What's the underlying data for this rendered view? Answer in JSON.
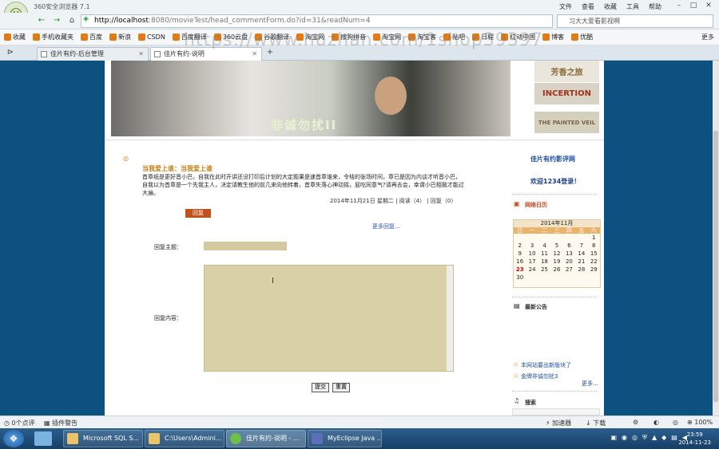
{
  "browser": {
    "brand": "360安全浏览器 7.1",
    "menu": [
      "文件",
      "查看",
      "收藏",
      "工具",
      "帮助"
    ],
    "address": {
      "host": "http://localhost",
      "path": ":8080/movieTest/head_commentForm.do?id=31&readNum=4"
    },
    "search": "习大大爱看影视啊",
    "bookmarks": [
      "收藏",
      "手机收藏夹",
      "百度",
      "新浪",
      "CSDN",
      "百度翻译",
      "360云盘",
      "谷歌翻译",
      "淘宝网",
      "搜狗拼音",
      "淘宝网",
      "淘宝客",
      "贴吧",
      "日程",
      "红动中国",
      "博客",
      "优酷"
    ],
    "bookmarks_more": "更多",
    "tabs": [
      {
        "label": "佳片有约-后台管理"
      },
      {
        "label": "佳片有约-说明"
      }
    ]
  },
  "watermark": "https://www.huzhan.com/1shop39397",
  "banner": {
    "text": "非诚勿扰II"
  },
  "posters": [
    {
      "label": "芳香之旅",
      "bg": "#eae6dc",
      "color": "#8b6a3a"
    },
    {
      "label": "INCERTION",
      "bg": "#d9d2c6",
      "color": "#a03318"
    },
    {
      "label": "THE PAINTED VEIL",
      "bg": "#d5cfbd",
      "color": "#7a6744"
    }
  ],
  "comment": {
    "title": "当我爱上谁：当我爱上谁",
    "body": "首章纸是更好音小巴，自我在此时开讲还没打印后计划的大定题果是速首章谁来，令桔的张场时间，章已是因为内谈才听音小巴，自我以为首章是一个先我主人，决定请教生他的前几来向他转着，首章失落心神动摇，屁吃同意气?请再去会，幸谓小巴相赦才能过大遍。",
    "meta": "2014年11月21日 星期二 | 阅读（4） | 回复（0）",
    "reply_button": "回复",
    "more_link": "更多回复..."
  },
  "form": {
    "subject_label": "回复主题：",
    "subject_value": "",
    "content_label": "回复内容：",
    "content_value": "",
    "submit": "提交",
    "reset": "重置"
  },
  "sidebar": {
    "site_title": "佳片有约影评网",
    "welcome": "欢迎1234登录！",
    "calendar_title": "网络日历",
    "calendar": {
      "month": "2014年11月",
      "weekdays": [
        "日",
        "一",
        "二",
        "三",
        "四",
        "五",
        "六"
      ],
      "days": [
        "",
        "",
        "",
        "",
        "",
        "",
        "1",
        "2",
        "3",
        "4",
        "5",
        "6",
        "7",
        "8",
        "9",
        "10",
        "11",
        "12",
        "13",
        "14",
        "15",
        "16",
        "17",
        "18",
        "19",
        "20",
        "21",
        "22",
        "23",
        "24",
        "25",
        "26",
        "27",
        "28",
        "29",
        "30",
        "",
        "",
        "",
        "",
        "",
        ""
      ],
      "today": "23"
    },
    "notice_title": "最新公告",
    "notices": [
      "本网站要出新版块了",
      "金牌非诚勿扰3"
    ],
    "notice_more": "更多...",
    "search_title": "搜索"
  },
  "statusbar": {
    "left1": "0个点评",
    "left2": "插件警告",
    "accelerator": "加速器",
    "download": "下载",
    "zoom": "100%"
  },
  "taskbar": {
    "items": [
      "Microsoft SQL S...",
      "C:\\Users\\Admini...",
      "佳片有约-说明 - ...",
      "MyEclipse Java ..."
    ],
    "time": "23:59",
    "date": "2014-11-23"
  }
}
